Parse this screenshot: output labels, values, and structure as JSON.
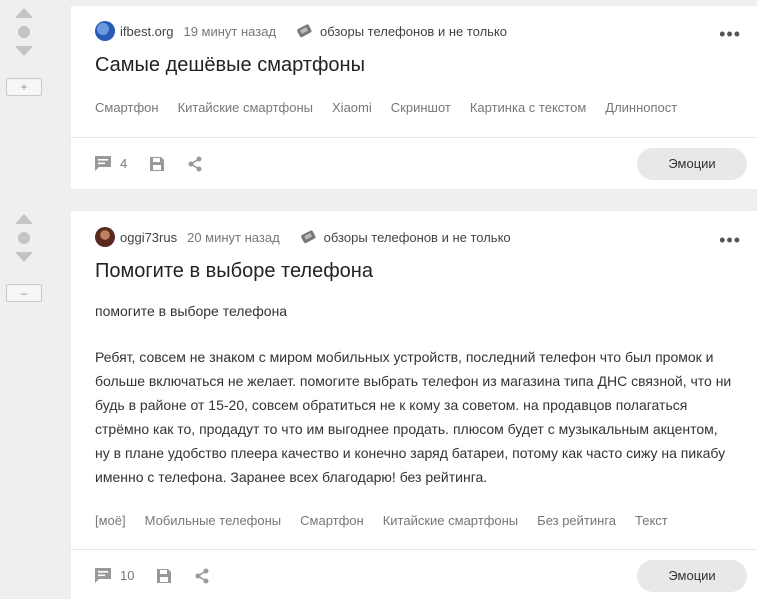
{
  "posts": [
    {
      "author": "ifbest.org",
      "time": "19 минут назад",
      "community": "обзоры телефонов и не только",
      "title": "Самые дешёвые смартфоны",
      "toggle": "+",
      "tags": [
        "Смартфон",
        "Китайские смартфоны",
        "Xiaomi",
        "Скриншот",
        "Картинка с текстом",
        "Длиннопост"
      ],
      "comments": "4",
      "emotions": "Эмоции"
    },
    {
      "author": "oggi73rus",
      "time": "20 минут назад",
      "community": "обзоры телефонов и не только",
      "title": "Помогите в выборе телефона",
      "toggle": "–",
      "subtitle": "помогите в выборе телефона",
      "body_lines": [
        "Ребят, совсем не знаком с миром мобильных устройств, последний телефон что был промок и",
        "больше включаться не желает. помогите выбрать телефон из магазина типа ДНС связной, что ни",
        "будь в районе от 15-20, совсем обратиться не к кому за советом. на продавцов полагаться",
        "стрёмно как то, продадут то что им выгоднее продать. плюсом будет с музыкальным акцентом,",
        "ну в плане удобство плеера качество и конечно заряд батареи, потому как часто сижу на пикабу",
        "именно с телефона. Заранее всех благодарю! без рейтинга."
      ],
      "tags": [
        "[моё]",
        "Мобильные телефоны",
        "Смартфон",
        "Китайские смартфоны",
        "Без рейтинга",
        "Текст"
      ],
      "comments": "10",
      "emotions": "Эмоции"
    }
  ],
  "more_label": "•••",
  "colors": {
    "background": "#efefef",
    "card": "#ffffff",
    "rating": "#c4c4c4",
    "button": "#e8e8e8"
  }
}
